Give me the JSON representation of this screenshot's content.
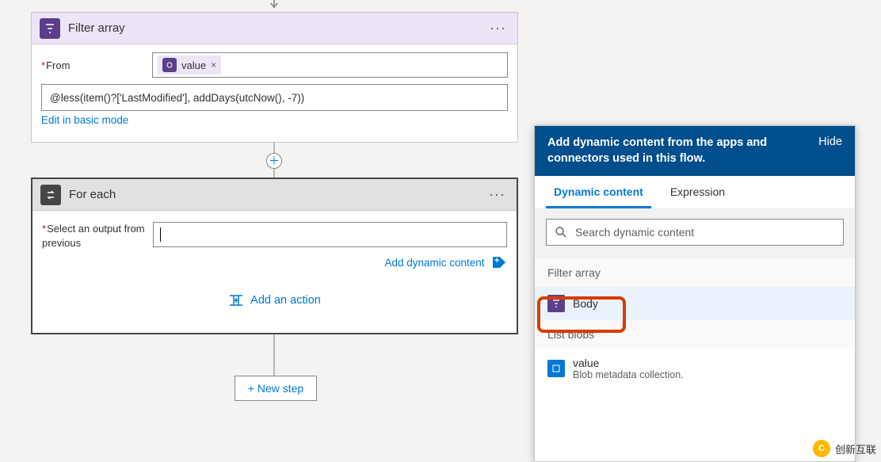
{
  "filter_card": {
    "title": "Filter array",
    "from_label": "From",
    "from_token": "value",
    "expression": "@less(item()?['LastModified'], addDays(utcNow(), -7))",
    "edit_link": "Edit in basic mode"
  },
  "foreach_card": {
    "title": "For each",
    "select_label": "Select an output from previous",
    "input_value": "",
    "add_dynamic": "Add dynamic content",
    "add_action": "Add an action"
  },
  "new_step": "+ New step",
  "panel": {
    "header": "Add dynamic content from the apps and connectors used in this flow.",
    "hide": "Hide",
    "tabs": {
      "dynamic": "Dynamic content",
      "expression": "Expression"
    },
    "search_placeholder": "Search dynamic content",
    "groups": [
      {
        "title": "Filter array",
        "items": [
          {
            "icon": "purple",
            "title": "Body",
            "subtitle": "",
            "selected": true
          }
        ]
      },
      {
        "title": "List blobs",
        "items": [
          {
            "icon": "blue",
            "title": "value",
            "subtitle": "Blob metadata collection.",
            "selected": false
          }
        ]
      }
    ]
  },
  "watermark": "创新互联"
}
